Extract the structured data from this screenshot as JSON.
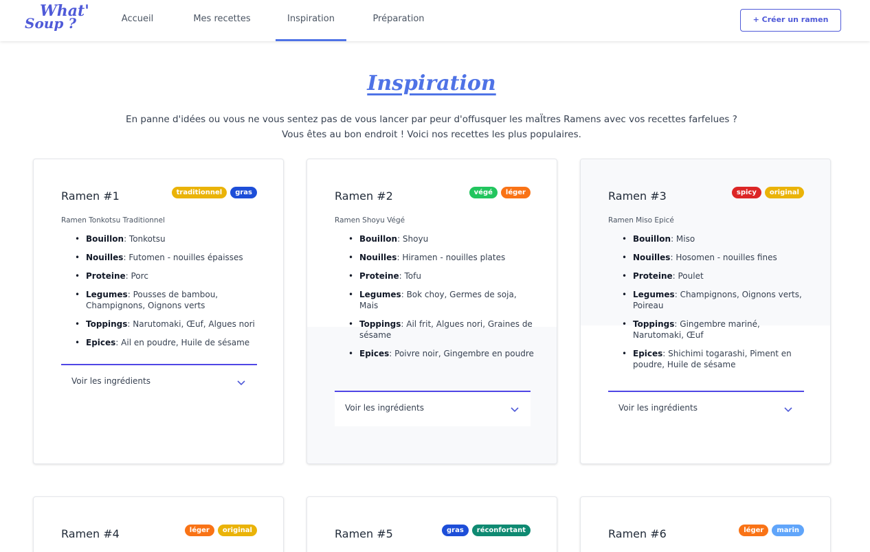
{
  "nav": {
    "logo_line1": "What'",
    "logo_line2": "Soup ?",
    "links": [
      "Accueil",
      "Mes recettes",
      "Inspiration",
      "Préparation"
    ],
    "create_button": "+ Créer un ramen"
  },
  "header": {
    "title": "Inspiration",
    "intro_line1": "En panne d'idées ou vous ne vous sentez pas de vous lancer par peur d'offusquer les maÏtres Ramens avec vos recettes farfelues ?",
    "intro_line2": "Vous êtes au bon endroit ! Voici nos recettes les plus populaires."
  },
  "colors": {
    "accent": "#4f5ad8",
    "tab_underline": "#4f73e6",
    "accordion_border": "#4f46e5"
  },
  "cards": [
    {
      "title": "Ramen #1",
      "tags": [
        {
          "label": "traditionnel",
          "color": "#eab308"
        },
        {
          "label": "gras",
          "color": "#1d4ed8"
        }
      ],
      "subtitle": "Ramen Tonkotsu Traditionnel",
      "items": [
        {
          "key": "Bouillon",
          "value": "Tonkotsu"
        },
        {
          "key": "Nouilles",
          "value": "Futomen - nouilles épaisses"
        },
        {
          "key": "Proteine",
          "value": "Porc"
        },
        {
          "key": "Legumes",
          "value": "Pousses de bambou, Champignons, Oignons verts"
        },
        {
          "key": "Toppings",
          "value": "Narutomaki, Œuf, Algues nori"
        },
        {
          "key": "Epices",
          "value": "Ail en poudre, Huile de sésame"
        }
      ],
      "toggle": "Voir les ingrédients"
    },
    {
      "title": "Ramen #2",
      "tags": [
        {
          "label": "végé",
          "color": "#22c55e"
        },
        {
          "label": "léger",
          "color": "#f97316"
        }
      ],
      "subtitle": "Ramen Shoyu Végé",
      "items": [
        {
          "key": "Bouillon",
          "value": "Shoyu"
        },
        {
          "key": "Nouilles",
          "value": "Hiramen - nouilles plates"
        },
        {
          "key": "Proteine",
          "value": "Tofu"
        },
        {
          "key": "Legumes",
          "value": "Bok choy, Germes de soja, Mais"
        },
        {
          "key": "Toppings",
          "value": "Ail frit, Algues nori, Graines de sésame"
        },
        {
          "key": "Epices",
          "value": "Poivre noir, Gingembre en poudre"
        }
      ],
      "toggle": "Voir les ingrédients"
    },
    {
      "title": "Ramen #3",
      "tags": [
        {
          "label": "spicy",
          "color": "#dc2626"
        },
        {
          "label": "original",
          "color": "#eab308"
        }
      ],
      "subtitle": "Ramen Miso Epicé",
      "items": [
        {
          "key": "Bouillon",
          "value": "Miso"
        },
        {
          "key": "Nouilles",
          "value": "Hosomen - nouilles fines"
        },
        {
          "key": "Proteine",
          "value": "Poulet"
        },
        {
          "key": "Legumes",
          "value": "Champignons, Oignons verts, Poireau"
        },
        {
          "key": "Toppings",
          "value": "Gingembre mariné, Narutomaki, Œuf"
        },
        {
          "key": "Epices",
          "value": "Shichimi togarashi, Piment en poudre, Huile de sésame"
        }
      ],
      "toggle": "Voir les ingrédients"
    },
    {
      "title": "Ramen #4",
      "tags": [
        {
          "label": "léger",
          "color": "#f97316"
        },
        {
          "label": "original",
          "color": "#eab308"
        }
      ]
    },
    {
      "title": "Ramen #5",
      "tags": [
        {
          "label": "gras",
          "color": "#1d4ed8"
        },
        {
          "label": "réconfortant",
          "color": "#0f8a72"
        }
      ]
    },
    {
      "title": "Ramen #6",
      "tags": [
        {
          "label": "léger",
          "color": "#f97316"
        },
        {
          "label": "marin",
          "color": "#60a5fa"
        }
      ]
    }
  ]
}
